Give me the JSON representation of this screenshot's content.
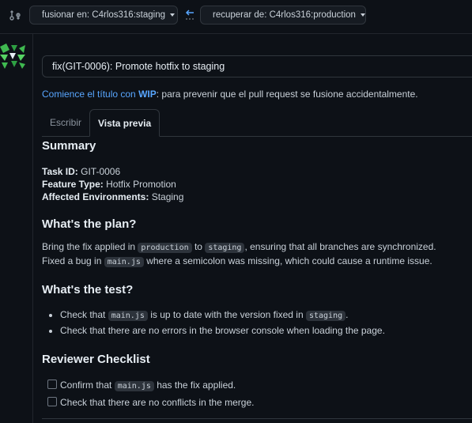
{
  "topbar": {
    "base_branch": "fusionar en: C4rlos316:staging",
    "head_branch": "recuperar de: C4rlos316:production"
  },
  "pr": {
    "title_value": "fix(GIT-0006): Promote hotfix to staging",
    "tip_link": "Comience el título con",
    "tip_wip": "WIP",
    "tip_rest": ": para prevenir que el pull request se fusione accidentalmente."
  },
  "tabs": {
    "write": "Escribir",
    "preview": "Vista previa"
  },
  "preview": {
    "summary_heading": "Summary",
    "task_id_label": "Task ID:",
    "task_id_value": " GIT-0006",
    "feature_type_label": "Feature Type:",
    "feature_type_value": " Hotfix Promotion",
    "affected_label": "Affected Environments:",
    "affected_value": " Staging",
    "plan_heading": "What's the plan?",
    "plan_1a": "Bring the fix applied in ",
    "plan_1_code1": "production",
    "plan_1b": " to ",
    "plan_1_code2": "staging",
    "plan_1c": ", ensuring that all branches are synchronized.",
    "plan_2a": "Fixed a bug in ",
    "plan_2_code": "main.js",
    "plan_2b": " where a semicolon was missing, which could cause a runtime issue.",
    "test_heading": "What's the test?",
    "test_1a": "Check that ",
    "test_1_code1": "main.js",
    "test_1b": " is up to date with the version fixed in ",
    "test_1_code2": "staging",
    "test_1c": ".",
    "test_2": "Check that there are no errors in the browser console when loading the page.",
    "checklist_heading": "Reviewer Checklist",
    "check_1a": "Confirm that ",
    "check_1_code": "main.js",
    "check_1b": " has the fix applied.",
    "check_2": "Check that there are no conflicts in the merge."
  },
  "colors": {
    "background": "#0d1117",
    "link": "#58a6ff",
    "border": "#30363d"
  },
  "icons": [
    "compare-branches-icon",
    "arrow-left-icon",
    "avatar-identicon"
  ]
}
